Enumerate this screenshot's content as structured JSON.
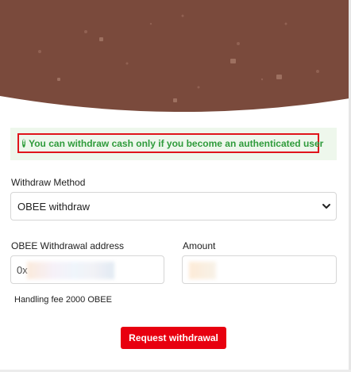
{
  "alert": {
    "message": "You can withdraw cash only if you become an authenticated user",
    "icon": "exclamation-circle-icon",
    "color": "#2f9b3b"
  },
  "form": {
    "method_label": "Withdraw Method",
    "method_value": "OBEE withdraw",
    "address_label": "OBEE Withdrawal address",
    "address_value": "0x",
    "amount_label": "Amount",
    "amount_value": "",
    "fee_text": "Handling fee 2000 OBEE"
  },
  "actions": {
    "request_label": "Request withdrawal",
    "accent": "#e8000f"
  },
  "banner": {
    "color": "#7a4a3c"
  }
}
